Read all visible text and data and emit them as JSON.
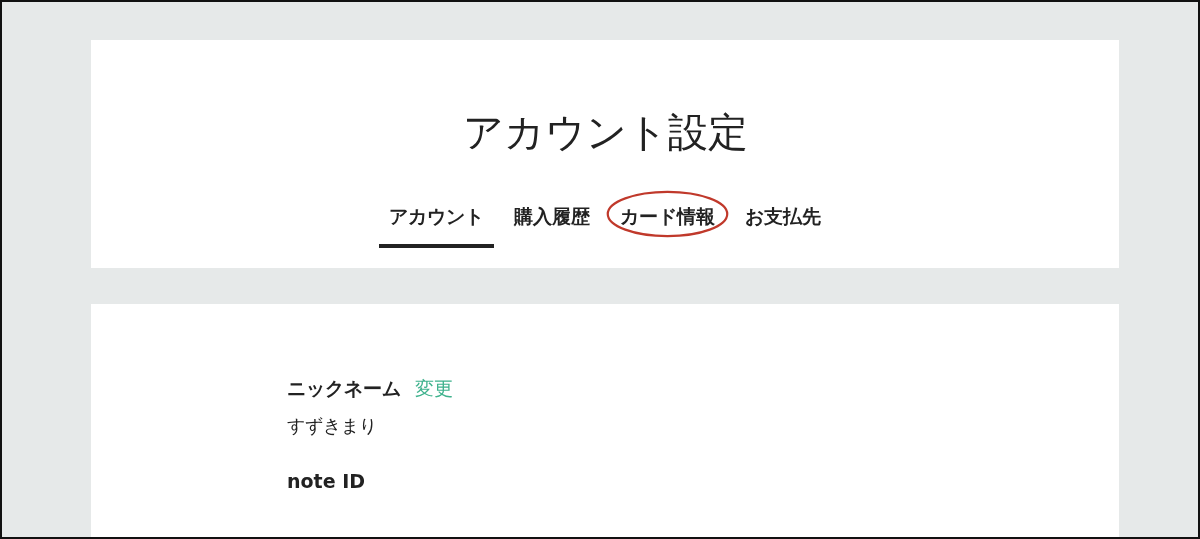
{
  "page_title": "アカウント設定",
  "tabs": [
    {
      "label": "アカウント",
      "selected": true
    },
    {
      "label": "購入履歴",
      "selected": false
    },
    {
      "label": "カード情報",
      "selected": false,
      "circled": true
    },
    {
      "label": "お支払先",
      "selected": false
    }
  ],
  "fields": [
    {
      "label": "ニックネーム",
      "action": "変更",
      "value": "すずきまり"
    },
    {
      "label": "note ID"
    }
  ]
}
